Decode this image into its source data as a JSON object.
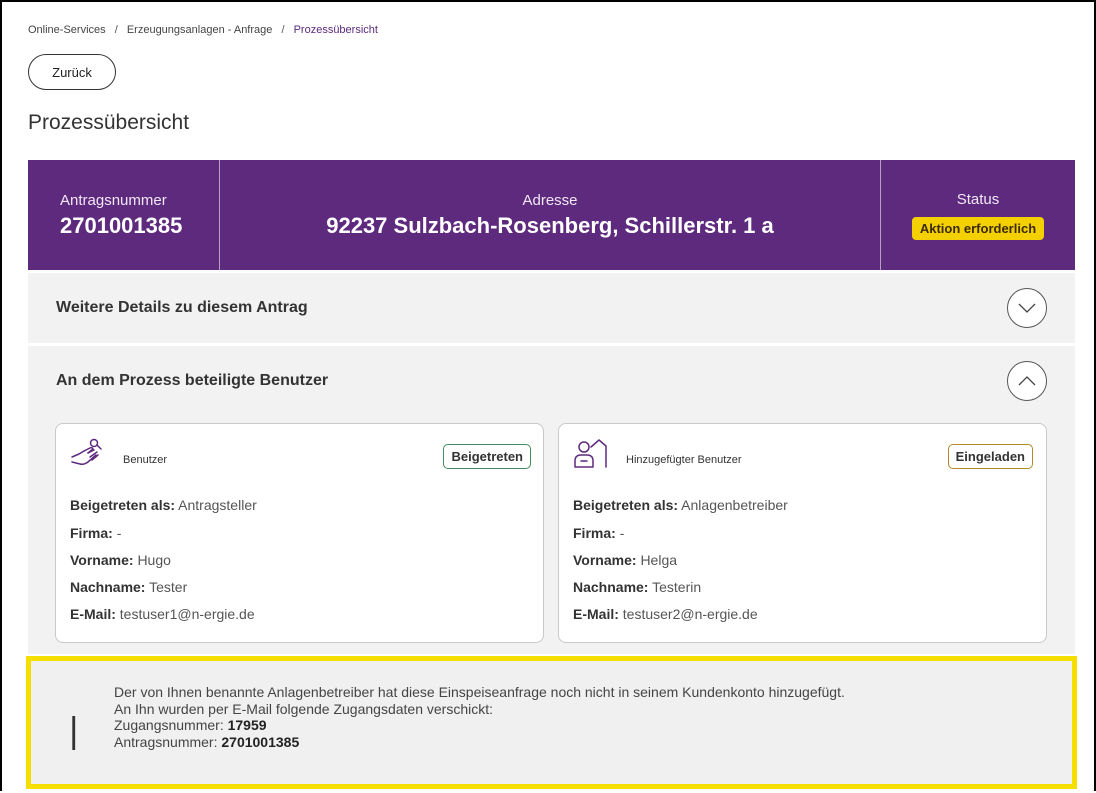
{
  "breadcrumb": {
    "items": [
      "Online-Services",
      "Erzeugungsanlagen - Anfrage",
      "Prozessübersicht"
    ],
    "separator": "/"
  },
  "back_button": {
    "label": "Zurück"
  },
  "page_title": "Prozessübersicht",
  "header": {
    "number_label": "Antragsnummer",
    "number_value": "2701001385",
    "address_label": "Adresse",
    "address_value": "92237 Sulzbach-Rosenberg, Schillerstr. 1 a",
    "status_label": "Status",
    "status_value": "Aktion erforderlich"
  },
  "accordions": [
    {
      "title": "Weitere Details zu diesem Antrag",
      "expanded": false,
      "icon": "chevron-down-icon"
    },
    {
      "title": "An dem Prozess beteiligte Benutzer",
      "expanded": true,
      "icon": "chevron-up-icon"
    }
  ],
  "users": [
    {
      "role": "Benutzer",
      "icon": "handshake-icon",
      "badge": "Beigetreten",
      "fields": [
        {
          "label": "Beigetreten als:",
          "value": "Antragsteller"
        },
        {
          "label": "Firma:",
          "value": "-"
        },
        {
          "label": "Vorname:",
          "value": "Hugo"
        },
        {
          "label": "Nachname:",
          "value": "Tester"
        },
        {
          "label": "E-Mail:",
          "value": "testuser1@n-ergie.de"
        }
      ]
    },
    {
      "role": "Hinzugefügter Benutzer",
      "icon": "person-house-icon",
      "badge": "Eingeladen",
      "fields": [
        {
          "label": "Beigetreten als:",
          "value": "Anlagenbetreiber"
        },
        {
          "label": "Firma:",
          "value": "-"
        },
        {
          "label": "Vorname:",
          "value": "Helga"
        },
        {
          "label": "Nachname:",
          "value": "Testerin"
        },
        {
          "label": "E-Mail:",
          "value": "testuser2@n-ergie.de"
        }
      ]
    }
  ],
  "info": {
    "icon": "info-icon",
    "line1": "Der von Ihnen benannte Anlagenbetreiber hat diese Einspeiseanfrage noch nicht in seinem Kundenkonto hinzugefügt.",
    "line2": "An Ihn wurden per E-Mail folgende Zugangsdaten verschickt:",
    "access_label": "Zugangsnummer:",
    "access_value": "17959",
    "number_label": "Antragsnummer:",
    "number_value": "2701001385"
  },
  "colors": {
    "brand_purple": "#5e2a7e",
    "status_yellow": "#f4d000",
    "info_border": "#f6df00",
    "joined_green": "#3f8f5e",
    "invited_gold": "#b08a23"
  }
}
